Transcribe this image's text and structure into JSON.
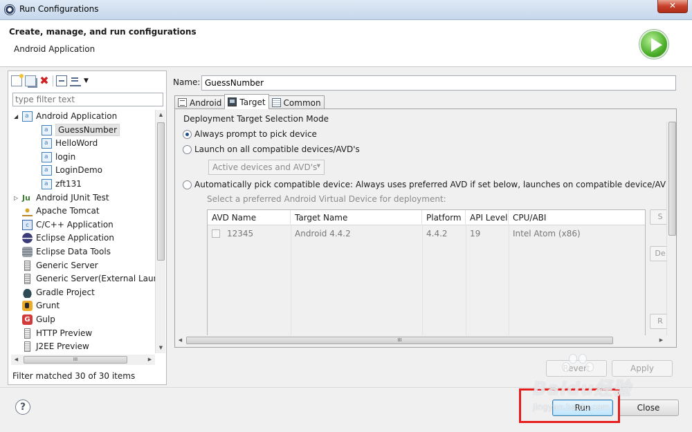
{
  "window": {
    "title": "Run Configurations",
    "close_label": "✕"
  },
  "header": {
    "title": "Create, manage, and run configurations",
    "subtitle": "Android Application"
  },
  "sidebar": {
    "filter_placeholder": "type filter text",
    "items": [
      {
        "label": "Android Application",
        "icon": "android-app-icon",
        "level": 0,
        "expanded": true
      },
      {
        "label": "GuessNumber",
        "icon": "android-app-icon",
        "level": 1,
        "selected": true
      },
      {
        "label": "HelloWord",
        "icon": "android-app-icon",
        "level": 1
      },
      {
        "label": "login",
        "icon": "android-app-icon",
        "level": 1
      },
      {
        "label": "LoginDemo",
        "icon": "android-app-icon",
        "level": 1
      },
      {
        "label": "zft131",
        "icon": "android-app-icon",
        "level": 1
      },
      {
        "label": "Android JUnit Test",
        "icon": "junit-icon",
        "level": 0,
        "collapsed": true
      },
      {
        "label": "Apache Tomcat",
        "icon": "tomcat-icon",
        "level": 0
      },
      {
        "label": "C/C++ Application",
        "icon": "cpp-icon",
        "level": 0
      },
      {
        "label": "Eclipse Application",
        "icon": "eclipse-icon",
        "level": 0
      },
      {
        "label": "Eclipse Data Tools",
        "icon": "data-tools-icon",
        "level": 0
      },
      {
        "label": "Generic Server",
        "icon": "server-icon",
        "level": 0
      },
      {
        "label": "Generic Server(External Laun",
        "icon": "server-icon",
        "level": 0
      },
      {
        "label": "Gradle Project",
        "icon": "gradle-icon",
        "level": 0
      },
      {
        "label": "Grunt",
        "icon": "grunt-icon",
        "level": 0
      },
      {
        "label": "Gulp",
        "icon": "gulp-icon",
        "level": 0
      },
      {
        "label": "HTTP Preview",
        "icon": "http-preview-icon",
        "level": 0
      },
      {
        "label": "J2EE Preview",
        "icon": "j2ee-preview-icon",
        "level": 0
      }
    ],
    "status": "Filter matched 30 of 30 items"
  },
  "config": {
    "name_label": "Name:",
    "name_value": "GuessNumber",
    "tabs": [
      {
        "label": "Android",
        "icon": "android-tab-icon"
      },
      {
        "label": "Target",
        "icon": "target-tab-icon",
        "active": true
      },
      {
        "label": "Common",
        "icon": "common-tab-icon"
      }
    ],
    "target": {
      "group_label": "Deployment Target Selection Mode",
      "option_prompt": "Always prompt to pick device",
      "option_all": "Launch on all compatible devices/AVD's",
      "devices_select": "Active devices and AVD's",
      "option_auto": "Automatically pick compatible device: Always uses preferred AVD if set below, launches on compatible device/AVD othe",
      "hint": "Select a preferred Android Virtual Device for deployment:",
      "selected_option": "option_prompt",
      "columns": [
        "AVD Name",
        "Target Name",
        "Platform",
        "API Level",
        "CPU/ABI"
      ],
      "rows": [
        {
          "avd": "12345",
          "target": "Android 4.4.2",
          "platform": "4.4.2",
          "api": "19",
          "cpu": "Intel Atom (x86)"
        }
      ],
      "side_buttons": [
        "S",
        "De",
        "R"
      ]
    },
    "revert_label": "Revert",
    "apply_label": "Apply"
  },
  "footer": {
    "help": "?",
    "run_label": "Run",
    "close_label": "Close"
  },
  "watermark": {
    "text": "Baidu经验",
    "url": "jingyan.baidu.com"
  },
  "colors": {
    "highlight": "#e61b1b",
    "run_icon": "#4caf2a"
  }
}
